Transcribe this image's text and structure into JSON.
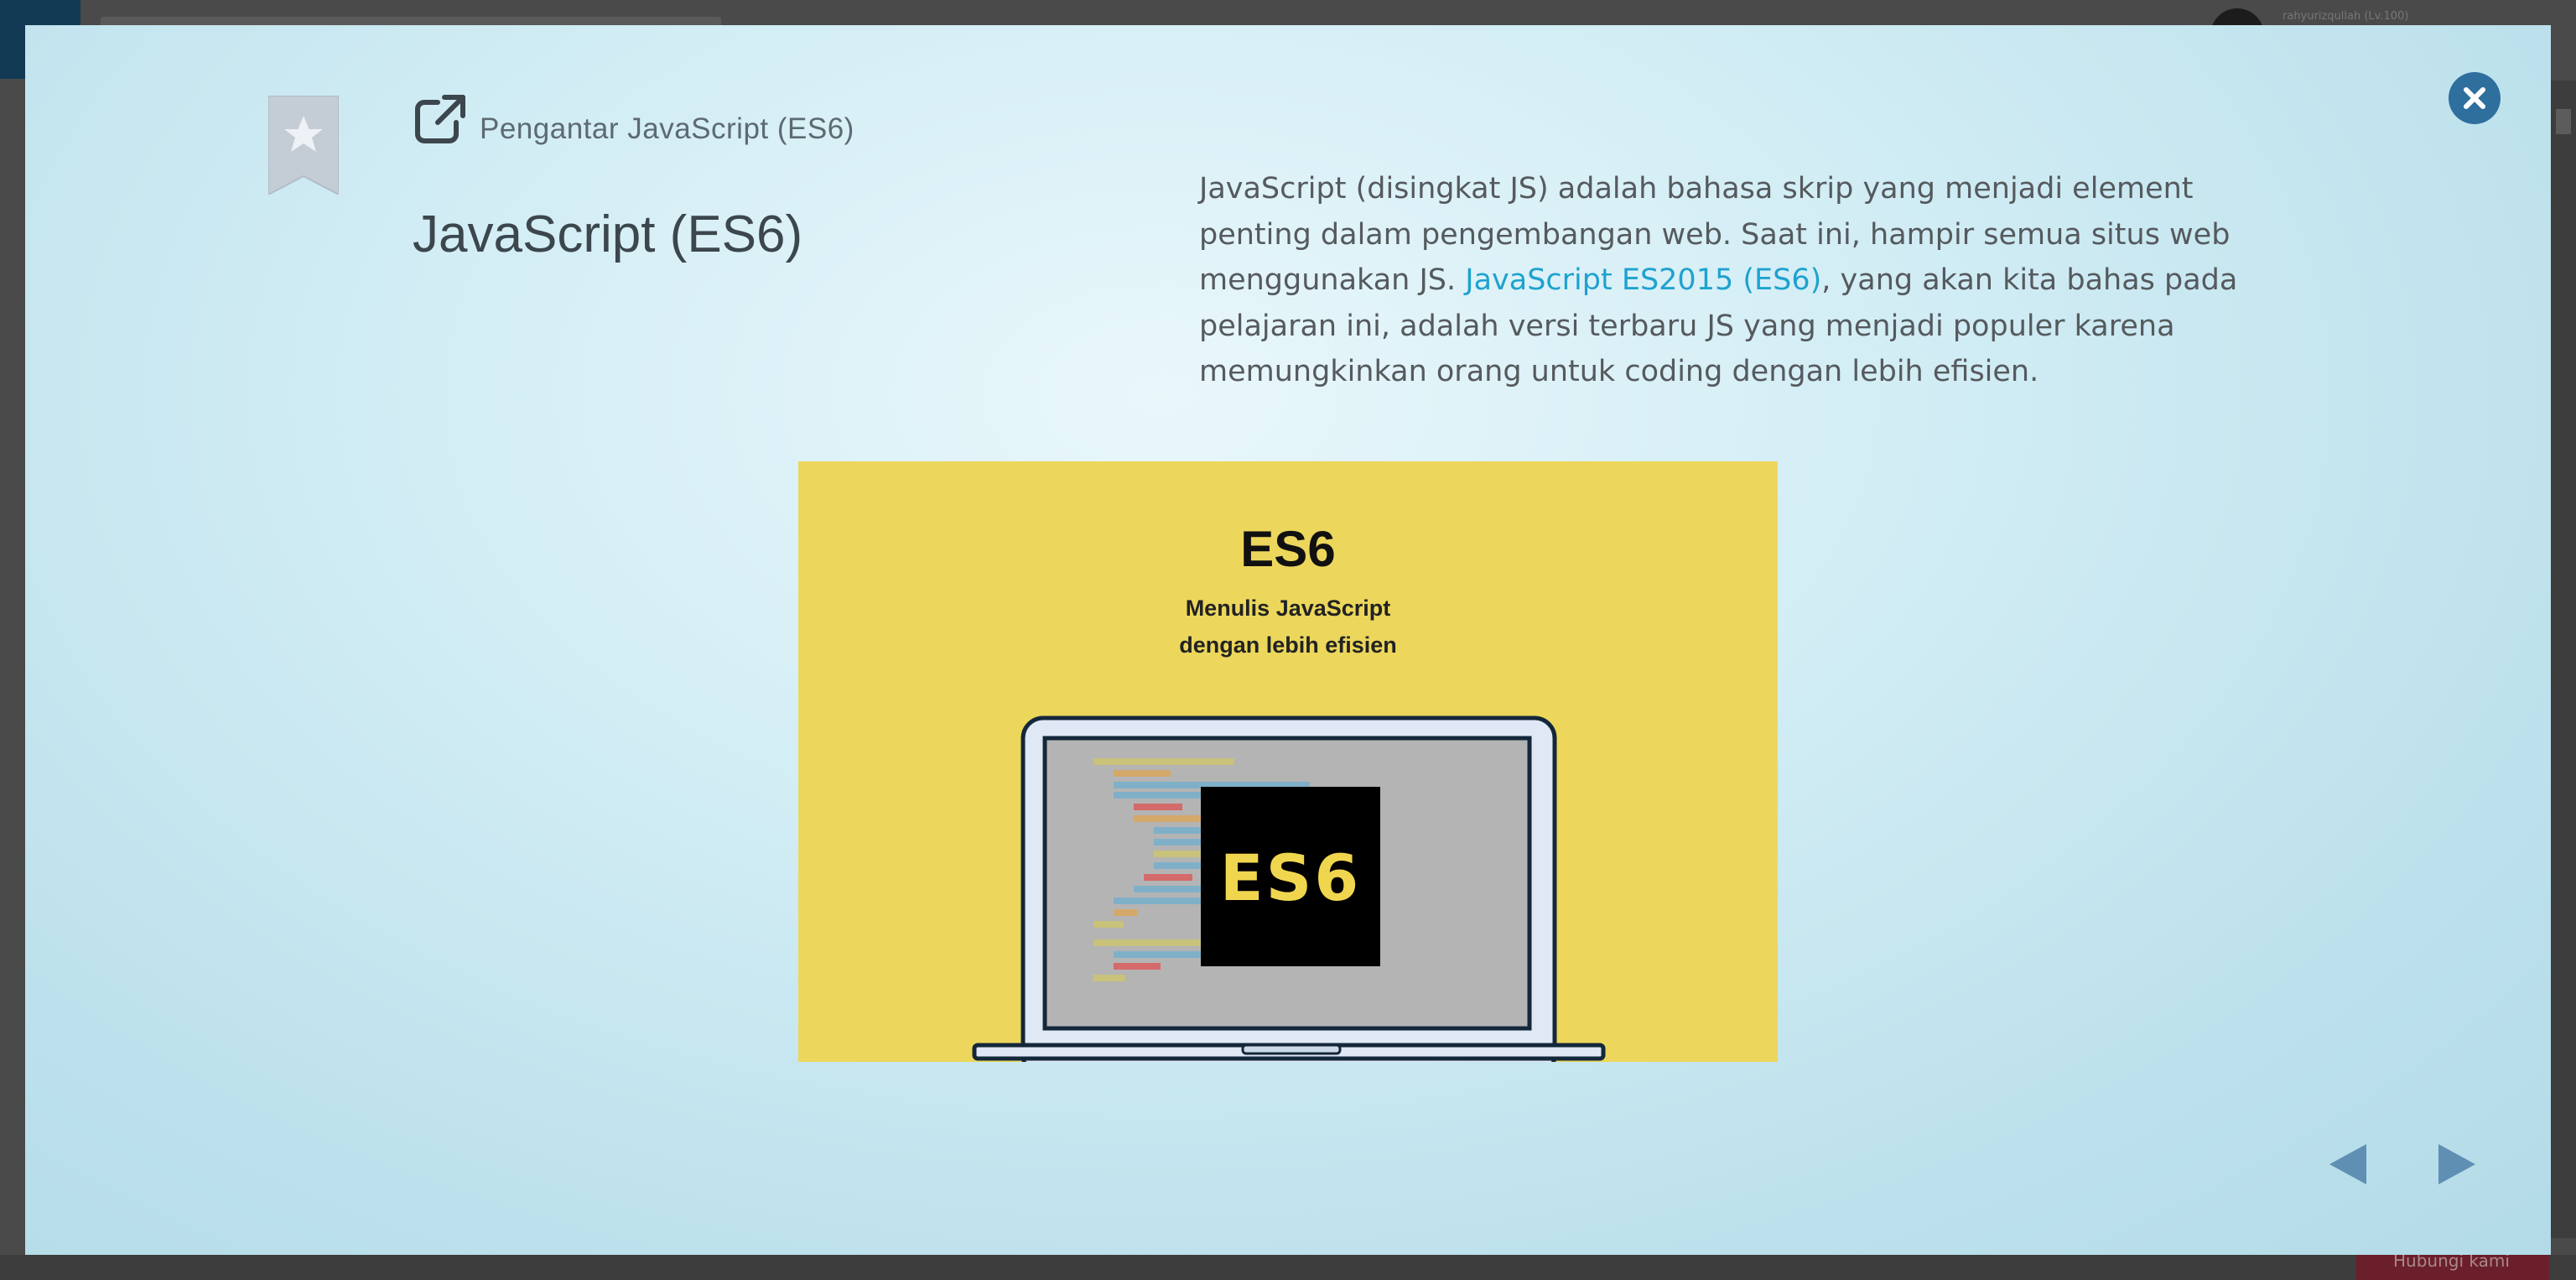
{
  "background": {
    "username": "rahyurizqullah (Lv.100)",
    "bottom_button": "Hubungi kami"
  },
  "modal": {
    "subtitle": "Pengantar JavaScript (ES6)",
    "title": "JavaScript (ES6)",
    "description": {
      "part1": "JavaScript (disingkat JS) adalah bahasa skrip yang menjadi element penting dalam pengembangan web. Saat ini, hampir semua situs web menggunakan JS. ",
      "link": "JavaScript ES2015 (ES6)",
      "part2": ", yang akan kita bahas pada pelajaran ini, adalah versi terbaru JS yang menjadi populer karena memungkinkan orang untuk coding dengan lebih efisien."
    },
    "illustration": {
      "heading": "ES6",
      "line1": "Menulis JavaScript",
      "line2": "dengan lebih efisien",
      "screen_badge": "ES6"
    }
  },
  "icons": {
    "bookmark": "bookmark-star-icon",
    "external_link": "external-link-icon",
    "close": "close-icon",
    "prev": "prev-arrow-icon",
    "next": "next-arrow-icon"
  },
  "colors": {
    "accent_link": "#1fa2cf",
    "close_button": "#2f6f9e",
    "illustration_bg": "#ecd75c"
  }
}
